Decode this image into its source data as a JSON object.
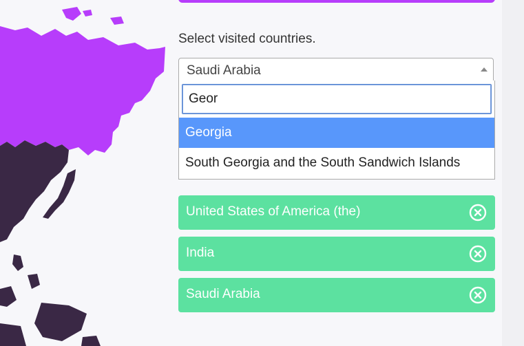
{
  "form": {
    "label": "Select visited countries.",
    "selected_value": "Saudi Arabia",
    "search_value": "Geor",
    "options": [
      "Georgia",
      "South Georgia and the South Sandwich Islands"
    ]
  },
  "chips": [
    {
      "label": "United States of America (the)"
    },
    {
      "label": "India"
    },
    {
      "label": "Saudi Arabia"
    }
  ],
  "colors": {
    "accent": "#b73dfb",
    "chip": "#5ce1a0",
    "highlight": "#5897fb",
    "map_dark": "#3a2845"
  },
  "icons": {
    "chip_remove": "circle-x-icon",
    "dropdown_arrow": "caret-up-icon"
  }
}
